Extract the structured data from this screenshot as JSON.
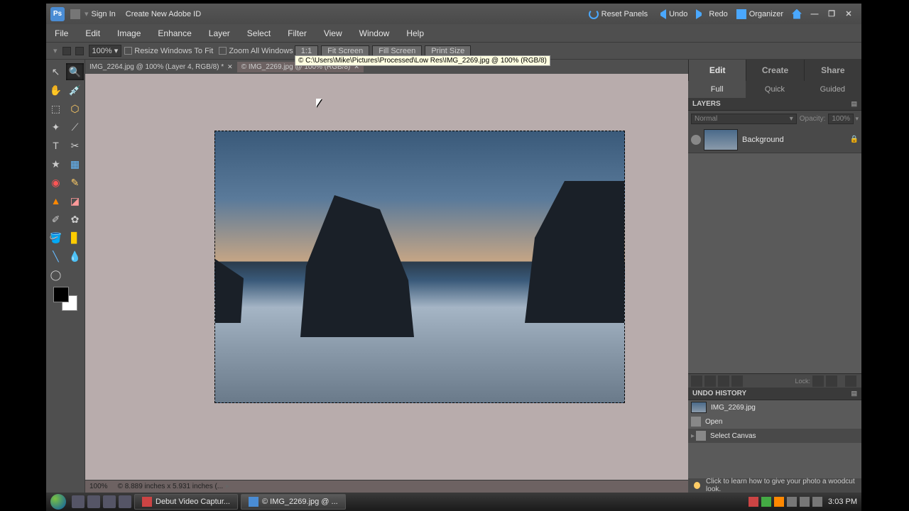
{
  "titlebar": {
    "signin": "Sign In",
    "create": "Create New Adobe ID",
    "reset": "Reset Panels",
    "undo": "Undo",
    "redo": "Redo",
    "organizer": "Organizer"
  },
  "menu": [
    "File",
    "Edit",
    "Image",
    "Enhance",
    "Layer",
    "Select",
    "Filter",
    "View",
    "Window",
    "Help"
  ],
  "options": {
    "zoom": "100%",
    "resize": "Resize Windows To Fit",
    "zoomall": "Zoom All Windows",
    "b1": "1:1",
    "b2": "Fit Screen",
    "b3": "Fill Screen",
    "b4": "Print Size",
    "tooltip": "© C:\\Users\\Mike\\Pictures\\Processed\\Low Res\\IMG_2269.jpg @ 100% (RGB/8)"
  },
  "tabs": [
    {
      "label": "IMG_2264.jpg @ 100% (Layer 4, RGB/8) *",
      "active": false
    },
    {
      "label": "© IMG_2269.jpg @ 100% (RGB/8)",
      "active": true
    }
  ],
  "status": {
    "zoom": "100%",
    "dims": "© 8.889 inches x 5.931 inches (..."
  },
  "rtabs": [
    "Edit",
    "Create",
    "Share"
  ],
  "subtabs": [
    "Full",
    "Quick",
    "Guided"
  ],
  "panels": {
    "layers": "LAYERS",
    "undo": "UNDO HISTORY"
  },
  "layeropts": {
    "blend": "Normal",
    "opacity_label": "Opacity:",
    "opacity": "100%"
  },
  "layer": {
    "name": "Background"
  },
  "layerbtns": {
    "lock": "Lock:"
  },
  "history": [
    {
      "label": "IMG_2269.jpg",
      "thumb": true
    },
    {
      "label": "Open",
      "thumb": false
    },
    {
      "label": "Select Canvas",
      "thumb": false,
      "selected": true
    }
  ],
  "hint": "Click to learn how to give your photo a woodcut look.",
  "taskbar": {
    "items": [
      {
        "label": "Debut Video Captur...",
        "active": false,
        "color": "#c44"
      },
      {
        "label": "© IMG_2269.jpg @ ...",
        "active": true,
        "color": "#4a8cd4"
      }
    ],
    "clock": "3:03 PM"
  }
}
